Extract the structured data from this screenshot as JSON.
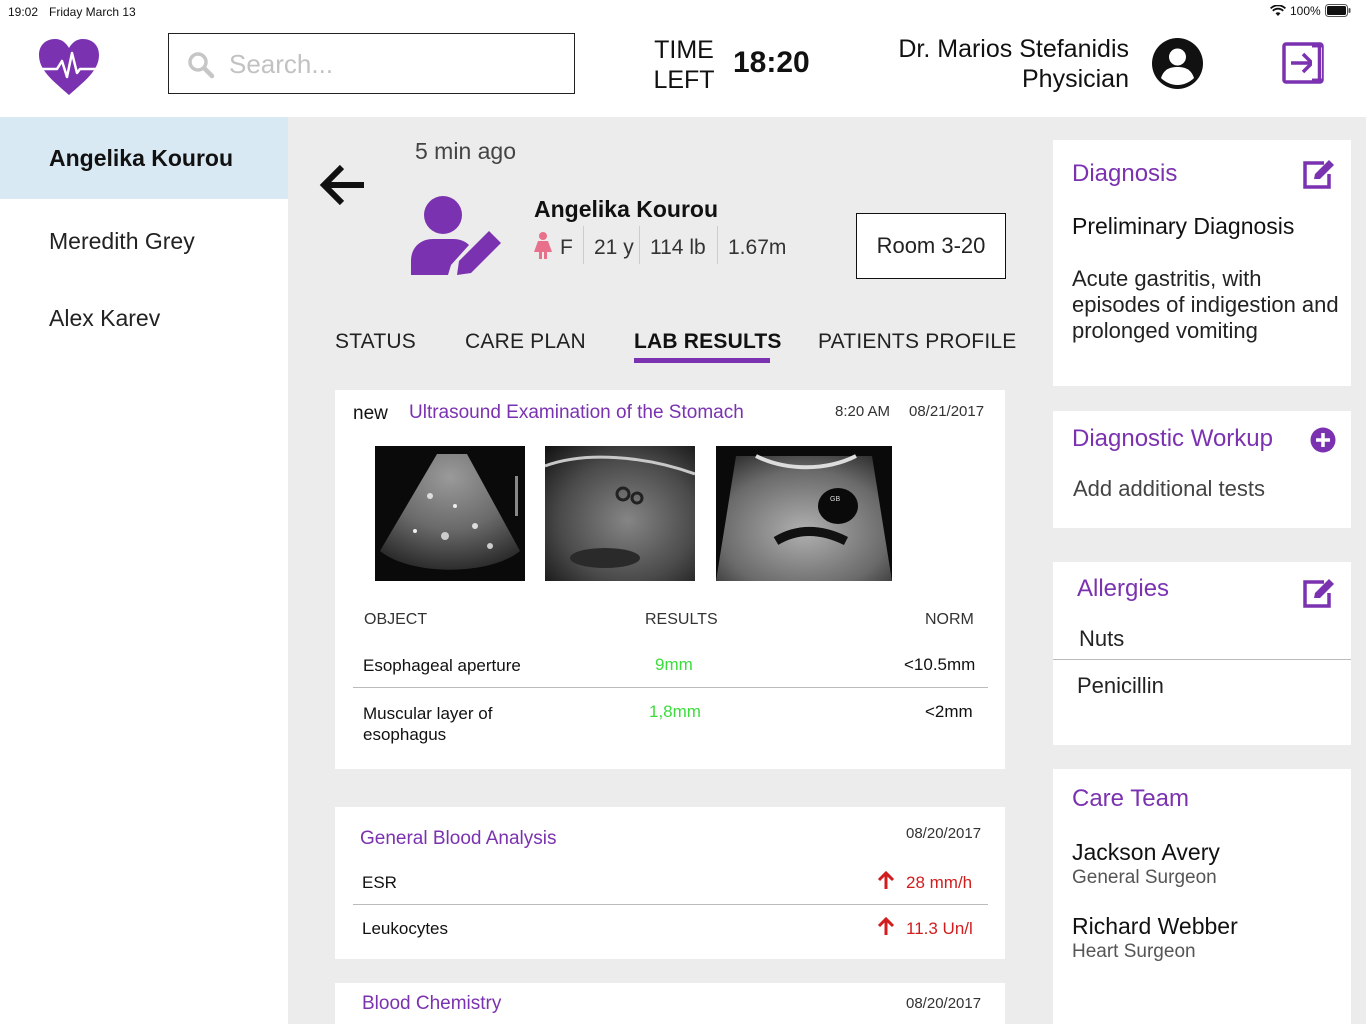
{
  "status_bar": {
    "time": "19:02",
    "date": "Friday March 13",
    "battery": "100%"
  },
  "header": {
    "search_placeholder": "Search...",
    "time_left_label_1": "TIME",
    "time_left_label_2": "LEFT",
    "time_left_value": "18:20",
    "doctor_name": "Dr. Marios Stefanidis",
    "doctor_role": "Physician"
  },
  "sidebar": {
    "items": [
      {
        "label": "Angelika Kourou",
        "active": true
      },
      {
        "label": "Meredith Grey"
      },
      {
        "label": "Alex Karev"
      }
    ]
  },
  "patient": {
    "updated": "5 min ago",
    "name": "Angelika Kourou",
    "sex": "F",
    "age": "21 y",
    "weight": "114 lb",
    "height": "1.67m",
    "room": "Room 3-20"
  },
  "tabs": [
    {
      "label": "STATUS"
    },
    {
      "label": "CARE PLAN"
    },
    {
      "label": "LAB RESULTS",
      "active": true
    },
    {
      "label": "PATIENTS PROFILE"
    }
  ],
  "ultrasound": {
    "badge": "new",
    "title": "Ultrasound Examination of the Stomach",
    "time": "8:20 AM",
    "date": "08/21/2017",
    "image_label": "GB",
    "columns": [
      "OBJECT",
      "RESULTS",
      "NORM"
    ],
    "rows": [
      {
        "object": "Esophageal aperture",
        "result": "9mm",
        "norm": "<10.5mm"
      },
      {
        "object": "Muscular layer of esophagus",
        "result": "1,8mm",
        "norm": "<2mm"
      }
    ]
  },
  "blood_analysis": {
    "title": "General Blood Analysis",
    "date": "08/20/2017",
    "rows": [
      {
        "name": "ESR",
        "value": "28 mm/h"
      },
      {
        "name": "Leukocytes",
        "value": "11.3 Un/l"
      }
    ]
  },
  "blood_chemistry": {
    "title": "Blood Chemistry",
    "date": "08/20/2017"
  },
  "diagnosis": {
    "title": "Diagnosis",
    "subtitle": "Preliminary Diagnosis",
    "text": "Acute gastritis, with episodes of indigestion and prolonged vomiting"
  },
  "workup": {
    "title": "Diagnostic Workup",
    "text": "Add additional tests"
  },
  "allergies": {
    "title": "Allergies",
    "items": [
      "Nuts",
      "Penicillin"
    ]
  },
  "care_team": {
    "title": "Care Team",
    "members": [
      {
        "name": "Jackson Avery",
        "role": "General Surgeon"
      },
      {
        "name": "Richard Webber",
        "role": "Heart Surgeon"
      }
    ]
  },
  "colors": {
    "accent": "#7b32b0",
    "active_row": "#d9e9f3",
    "good": "#3ddc3d",
    "bad": "#d11d1d",
    "female": "#e8708a"
  },
  "icons": [
    "heart-pulse-icon",
    "search-icon",
    "user-avatar-icon",
    "logout-icon",
    "back-arrow-icon",
    "patient-edit-icon",
    "female-icon",
    "edit-icon",
    "add-circle-icon",
    "arrow-up-icon",
    "wifi-icon",
    "battery-icon"
  ]
}
